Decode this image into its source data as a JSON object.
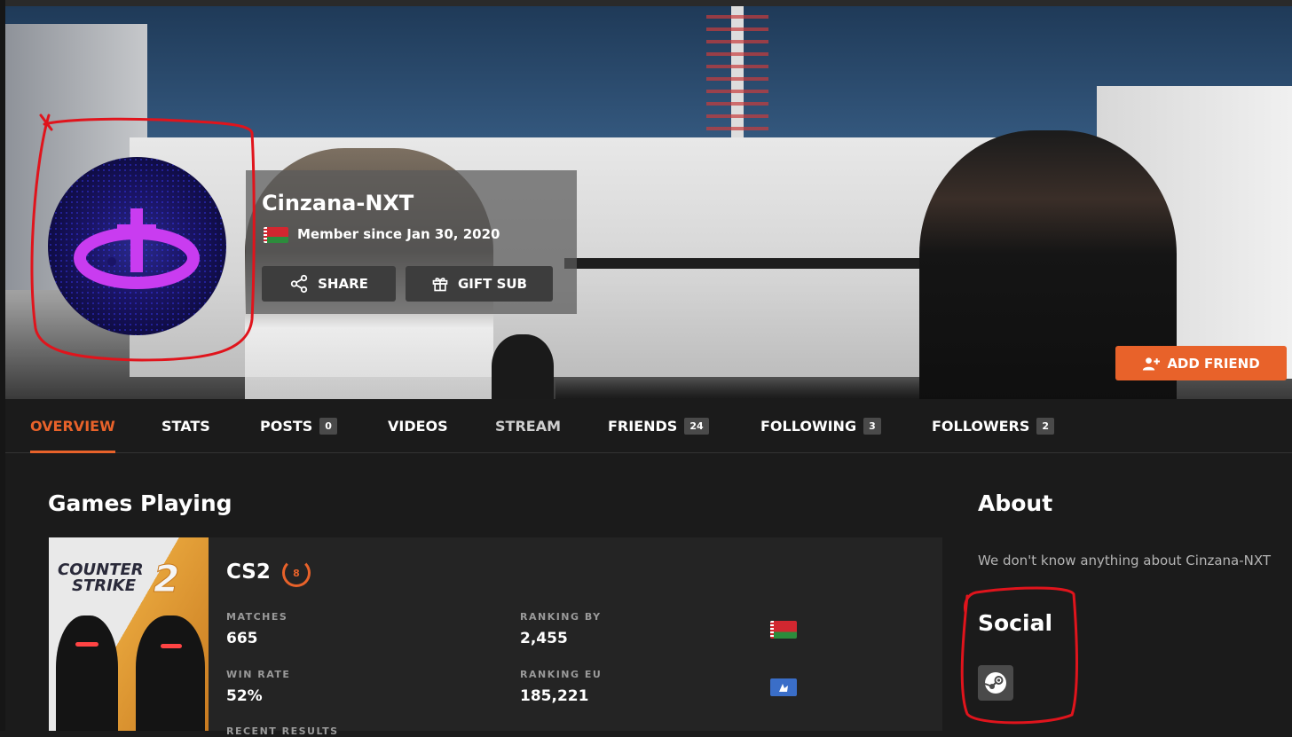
{
  "profile": {
    "username": "Cinzana-NXT",
    "member_since": "Member since Jan 30, 2020",
    "share_label": "SHARE",
    "gift_sub_label": "GIFT SUB",
    "add_friend_label": "ADD FRIEND"
  },
  "tabs": [
    {
      "label": "OVERVIEW",
      "count": null,
      "active": true
    },
    {
      "label": "STATS",
      "count": null
    },
    {
      "label": "POSTS",
      "count": "0"
    },
    {
      "label": "VIDEOS",
      "count": null
    },
    {
      "label": "STREAM",
      "count": null
    },
    {
      "label": "FRIENDS",
      "count": "24"
    },
    {
      "label": "FOLLOWING",
      "count": "3"
    },
    {
      "label": "FOLLOWERS",
      "count": "2"
    }
  ],
  "games": {
    "heading": "Games Playing",
    "cover_title_line1": "COUNTER",
    "cover_title_line2": "STRIKE",
    "cover_number": "2",
    "game": {
      "name": "CS2",
      "level": "8",
      "matches_label": "MATCHES",
      "matches": "665",
      "ranking_by_label": "RANKING BY",
      "ranking_by": "2,455",
      "win_rate_label": "WIN RATE",
      "win_rate": "52%",
      "ranking_eu_label": "RANKING EU",
      "ranking_eu": "185,221",
      "recent_results_label": "RECENT RESULTS"
    }
  },
  "about": {
    "heading": "About",
    "text": "We don't know anything about Cinzana-NXT"
  },
  "social": {
    "heading": "Social",
    "icons": [
      "steam-icon"
    ]
  },
  "colors": {
    "accent": "#e8622a",
    "background": "#1b1b1b",
    "card": "#242424",
    "annotation_red": "#e0141c"
  },
  "icons": [
    "share-icon",
    "gift-icon",
    "add-user-icon",
    "steam-icon",
    "flag-belarus-icon",
    "flag-europe-icon"
  ]
}
